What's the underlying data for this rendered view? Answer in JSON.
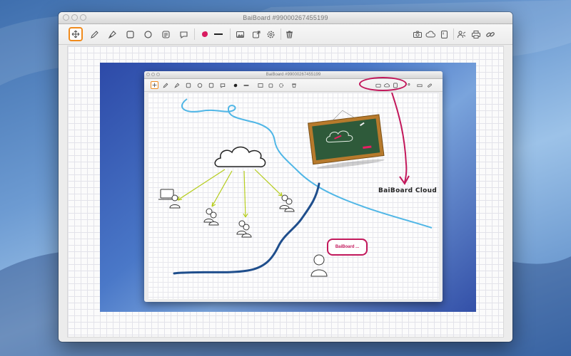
{
  "window": {
    "title": "BaiBoard #99000267455199"
  },
  "toolbar": {
    "tools": [
      {
        "name": "move-tool",
        "icon": "move-icon",
        "selected": true
      },
      {
        "name": "pencil-tool",
        "icon": "pencil-icon"
      },
      {
        "name": "pen-tool",
        "icon": "pen-icon"
      },
      {
        "name": "rectangle-tool",
        "icon": "rectangle-icon"
      },
      {
        "name": "circle-tool",
        "icon": "circle-icon"
      },
      {
        "name": "note-tool",
        "icon": "note-icon"
      },
      {
        "name": "speech-bubble-tool",
        "icon": "speech-bubble-icon"
      },
      {
        "name": "color-picker",
        "icon": "color-swatch-icon",
        "color": "#d81b60"
      },
      {
        "name": "line-width",
        "icon": "line-width-icon"
      },
      {
        "name": "insert-image",
        "icon": "image-icon"
      },
      {
        "name": "import",
        "icon": "import-icon"
      },
      {
        "name": "settings",
        "icon": "gear-icon"
      },
      {
        "name": "delete",
        "icon": "trash-icon"
      },
      {
        "name": "snapshot",
        "icon": "camera-icon"
      },
      {
        "name": "cloud",
        "icon": "cloud-icon"
      },
      {
        "name": "document",
        "icon": "document-icon"
      },
      {
        "name": "share",
        "icon": "share-icon"
      },
      {
        "name": "print",
        "icon": "printer-icon"
      },
      {
        "name": "link",
        "icon": "link-icon"
      }
    ]
  },
  "embedded_screenshot": {
    "window_title": "BaiBoard #99000267455199",
    "annotation_label": "BaiBoard Cloud",
    "bubble_text": "BaiBoard ..."
  },
  "colors": {
    "accent_selected": "#f08b1d",
    "annotation": "#c2185b",
    "river_light": "#4fb6e6",
    "river_dark": "#1f4e8c",
    "arrows": "#b5cc1c",
    "chalkboard": "#2e5a3a"
  }
}
